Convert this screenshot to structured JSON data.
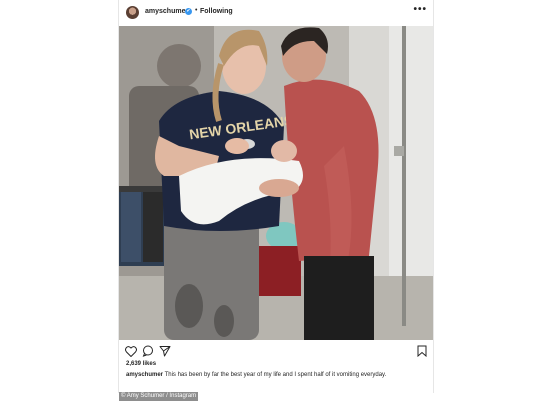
{
  "post": {
    "username": "amyschumer",
    "verified_mark": "✔",
    "separator": "•",
    "follow_status": "Following",
    "more_label": "•••",
    "likes": "2,639 likes",
    "caption_user": "amyschumer",
    "caption_text": "This has been by far the best year of my life and I spent half of it vomiting everyday.",
    "icons": [
      "heart-icon",
      "comment-icon",
      "share-icon",
      "bookmark-icon"
    ]
  },
  "credit": "© Amy Schumer / Instagram",
  "colors": {
    "verified": "#3897f0",
    "text": "#262626",
    "border": "#e6e6e6",
    "credit_bg": "#8e8e8e"
  }
}
